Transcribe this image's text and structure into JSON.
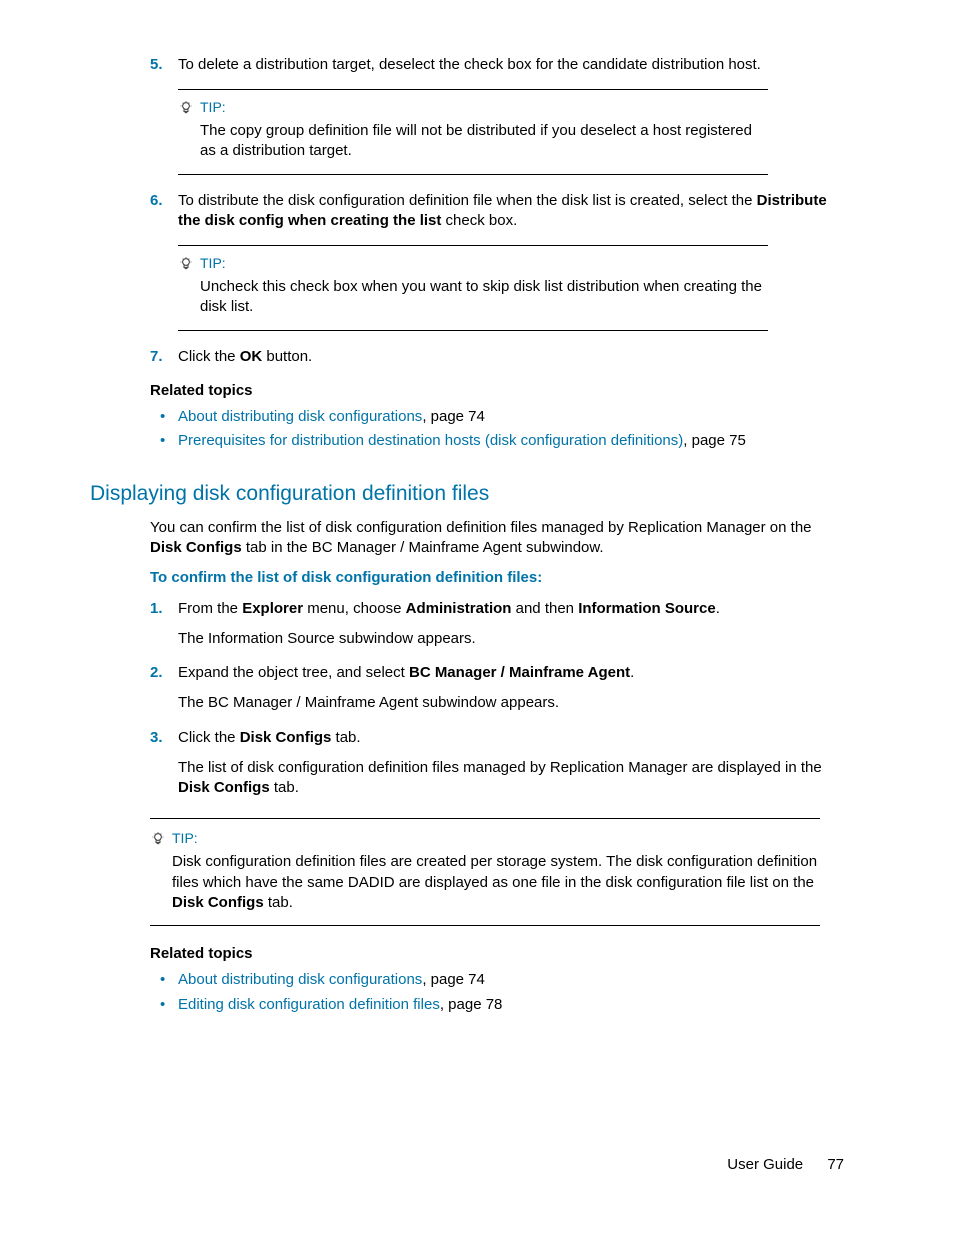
{
  "step5": {
    "num": "5.",
    "text_before": "To delete a distribution target, deselect the check box for the candidate distribution host."
  },
  "tip1": {
    "label": "TIP:",
    "text": "The copy group definition file will not be distributed if you deselect a host registered as a distribution target."
  },
  "step6": {
    "num": "6.",
    "t1": "To distribute the disk configuration definition file when the disk list is created, select the ",
    "b1": "Distribute the disk config when creating the list",
    "t2": " check box."
  },
  "tip2": {
    "label": "TIP:",
    "text": "Uncheck this check box when you want to skip disk list distribution when creating the disk list."
  },
  "step7": {
    "num": "7.",
    "t1": "Click the ",
    "b1": "OK",
    "t2": " button."
  },
  "related1": {
    "heading": "Related topics",
    "items": [
      {
        "link": "About distributing disk configurations",
        "suffix": ", page 74"
      },
      {
        "link": "Prerequisites for distribution destination hosts (disk configuration definitions)",
        "suffix": ", page 75"
      }
    ]
  },
  "h2": "Displaying disk configuration definition files",
  "intro": {
    "t1": "You can confirm the list of disk configuration definition files managed by Replication Manager on the ",
    "b1": "Disk Configs",
    "t2": " tab in the BC Manager / Mainframe Agent subwindow."
  },
  "subhead": "To confirm the list of disk configuration definition files:",
  "s1": {
    "num": "1.",
    "t1": "From the ",
    "b1": "Explorer",
    "t2": " menu, choose ",
    "b2": "Administration",
    "t3": " and then ",
    "b3": "Information Source",
    "t4": ".",
    "sub": "The Information Source subwindow appears."
  },
  "s2": {
    "num": "2.",
    "t1": "Expand the object tree, and select ",
    "b1": "BC Manager / Mainframe Agent",
    "t2": ".",
    "sub": "The BC Manager / Mainframe Agent subwindow appears."
  },
  "s3": {
    "num": "3.",
    "t1": "Click the ",
    "b1": "Disk Configs",
    "t2": " tab.",
    "sub_t1": "The list of disk configuration definition files managed by Replication Manager are displayed in the ",
    "sub_b1": "Disk Configs",
    "sub_t2": " tab."
  },
  "tip3": {
    "label": "TIP:",
    "t1": "Disk configuration definition files are created per storage system. The disk configuration definition files which have the same DADID are displayed as one file in the disk configuration file list on the ",
    "b1": "Disk Configs",
    "t2": " tab."
  },
  "related2": {
    "heading": "Related topics",
    "items": [
      {
        "link": "About distributing disk configurations",
        "suffix": ", page 74"
      },
      {
        "link": "Editing disk configuration definition files",
        "suffix": ", page 78"
      }
    ]
  },
  "footer": {
    "title": "User Guide",
    "page": "77"
  }
}
